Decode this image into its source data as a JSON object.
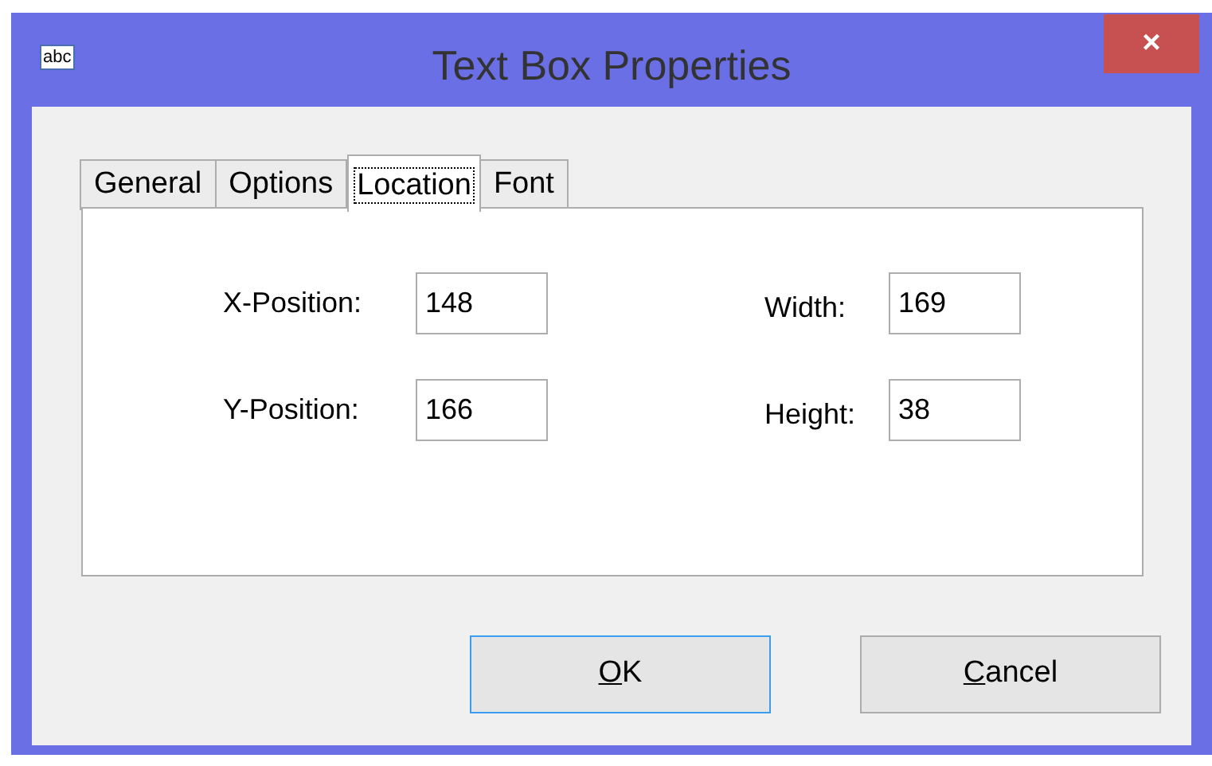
{
  "window": {
    "icon_text": "abc",
    "title": "Text Box Properties",
    "close": "×"
  },
  "tabs": [
    {
      "label": "General",
      "selected": false
    },
    {
      "label": "Options",
      "selected": false
    },
    {
      "label": "Location",
      "selected": true
    },
    {
      "label": "Font",
      "selected": false
    }
  ],
  "fields": [
    {
      "label": "X-Position:",
      "value": "148"
    },
    {
      "label": "Width:",
      "value": "169"
    },
    {
      "label": "Y-Position:",
      "value": "166"
    },
    {
      "label": "Height:",
      "value": "38"
    }
  ],
  "buttons": [
    {
      "label": "OK",
      "default": true
    },
    {
      "label": "Cancel",
      "default": false
    }
  ]
}
